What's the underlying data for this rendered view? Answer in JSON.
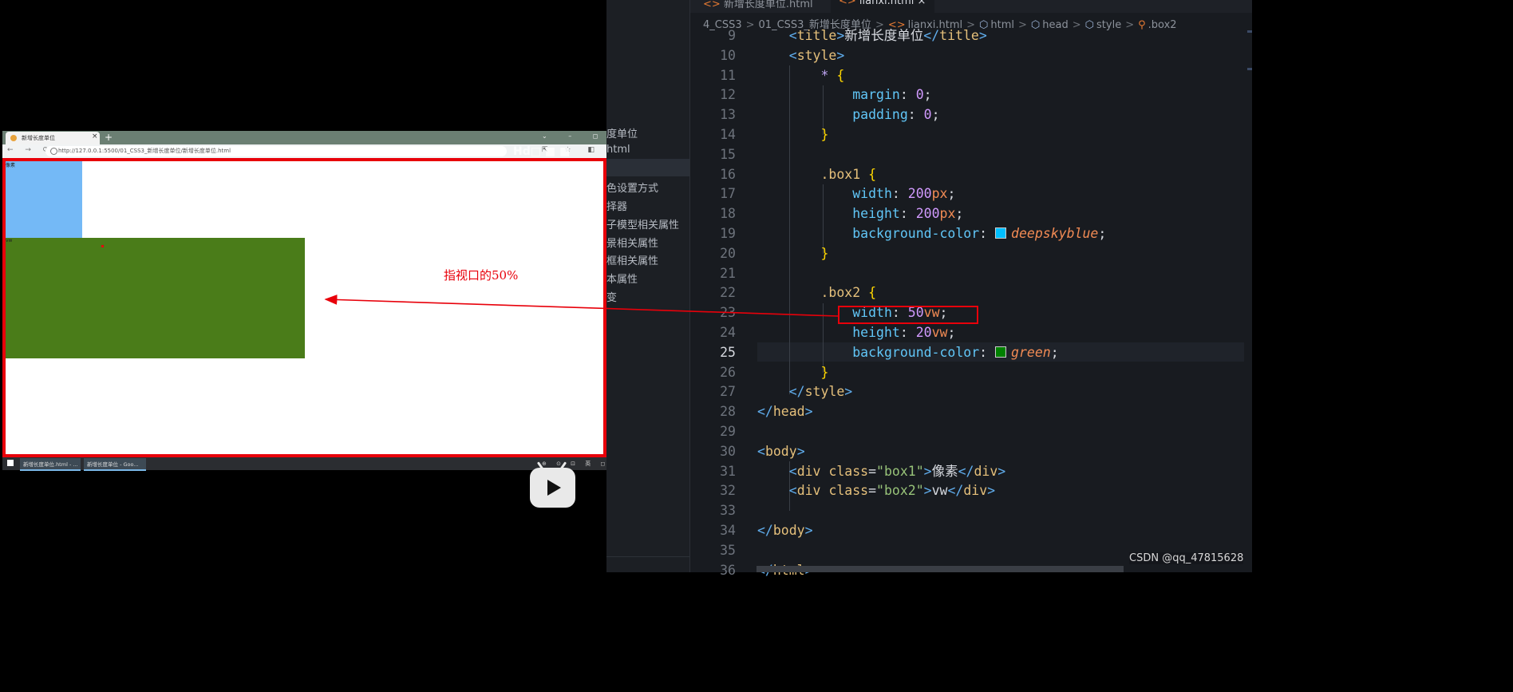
{
  "browser": {
    "tab_title": "新增长度单位",
    "tab_close": "×",
    "new_tab": "+",
    "window_controls": "⌄ – ◻ ✕",
    "nav_icons": "← → ⟳",
    "url": "http://127.0.0.1:5500/01_CSS3_新增长度单位/新增长度单位.html",
    "toolbar_icons": "⇱ ☆ ◧ ◉ ⋮",
    "ghost_watermark": "Hd□ ■ ■",
    "box1_label": "像素",
    "box2_label": "vw",
    "colors": {
      "box1": "#74b9f6",
      "box2": "#4a7c19",
      "frame": "#e8000a"
    }
  },
  "taskbar": {
    "items": [
      "新增长度单位.html - ...",
      "新增长度单位 - Goo..."
    ],
    "tray": "⊕ ⊙ ⊡ 英 ◻"
  },
  "explorer": {
    "items": [
      "度单位",
      "html",
      "色设置方式",
      "择器",
      "子模型相关属性",
      "景相关属性",
      "框相关属性",
      "本属性",
      "变"
    ]
  },
  "editor": {
    "tabs": [
      "新增长度单位.html",
      "lianxi.html"
    ],
    "tab_close": "×",
    "breadcrumb": [
      "4_CSS3",
      "01_CSS3_新增长度单位",
      "lianxi.html",
      "html",
      "head",
      "style",
      ".box2"
    ],
    "active_line": 25,
    "swatch_colors": {
      "deepskyblue": "#00bfff",
      "green": "#008000"
    }
  },
  "annotation": {
    "text": "指视口的50%"
  },
  "watermark": "CSDN @qq_47815628"
}
